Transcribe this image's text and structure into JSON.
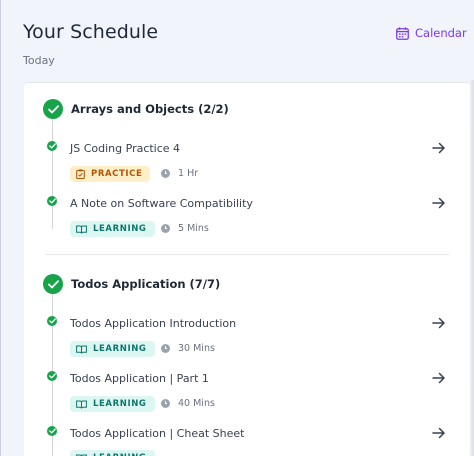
{
  "header": {
    "title": "Your Schedule",
    "subtitle": "Today",
    "calendar_label": "Calendar"
  },
  "sections": [
    {
      "title": "Arrays and Objects (2/2)",
      "items": [
        {
          "title": "JS Coding Practice 4",
          "type": "PRACTICE",
          "duration": "1 Hr"
        },
        {
          "title": "A Note on Software Compatibility",
          "type": "LEARNING",
          "duration": "5 Mins"
        }
      ]
    },
    {
      "title": "Todos Application (7/7)",
      "items": [
        {
          "title": "Todos Application Introduction",
          "type": "LEARNING",
          "duration": "30 Mins"
        },
        {
          "title": "Todos Application | Part 1",
          "type": "LEARNING",
          "duration": "40 Mins"
        },
        {
          "title": "Todos Application | Cheat Sheet",
          "type": "LEARNING",
          "duration": ""
        }
      ]
    }
  ],
  "colors": {
    "accent": "#7c3aed",
    "success": "#16a34a",
    "practice_bg": "#fdf0c9",
    "practice_fg": "#b45309",
    "learning_bg": "#dcf7f1",
    "learning_fg": "#0f766e"
  },
  "icons": {
    "calendar": "calendar-icon",
    "complete": "check-circle-icon",
    "arrow": "arrow-right-icon",
    "clock": "clock-icon",
    "practice": "clipboard-icon",
    "learning": "book-icon"
  }
}
